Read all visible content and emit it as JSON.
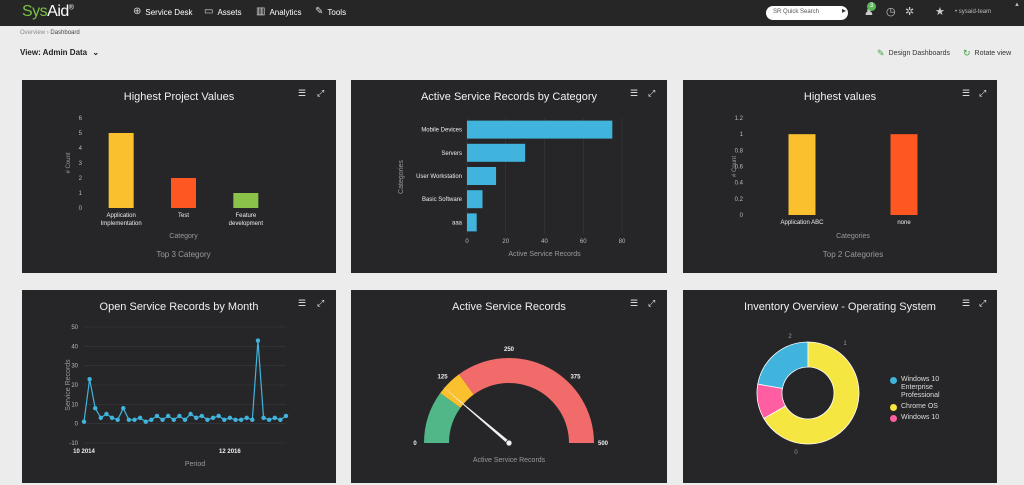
{
  "header": {
    "logo_a": "Sys",
    "logo_b": "Aid",
    "logo_mark": "®",
    "nav": [
      {
        "label": "Service Desk",
        "icon": "globe-icon"
      },
      {
        "label": "Assets",
        "icon": "monitor-icon"
      },
      {
        "label": "Analytics",
        "icon": "bar-chart-icon"
      },
      {
        "label": "Tools",
        "icon": "wrench-icon"
      }
    ],
    "search_placeholder": "SR Quick Search",
    "notification_count": "3",
    "user": "sysaid-team"
  },
  "breadcrumb": {
    "root": "Overview",
    "separator": "›",
    "current": "Dashboard"
  },
  "toolbar": {
    "view_label": "View: Admin Data",
    "design_label": "Design Dashboards",
    "rotate_label": "Rotate view"
  },
  "colors": {
    "card_bg": "#262629",
    "yellow": "#fbc02d",
    "orange": "#ff5722",
    "green": "#8bc34a",
    "blue": "#40b4dc",
    "pink": "#ff5fa2",
    "gauge_green": "#52b788",
    "gauge_red": "#f26b6b",
    "chrome_yellow": "#f5e642"
  },
  "cards": [
    {
      "title": "Highest Project Values"
    },
    {
      "title": "Active Service Records by Category"
    },
    {
      "title": "Highest values"
    },
    {
      "title": "Open Service Records by Month"
    },
    {
      "title": "Active Service Records"
    },
    {
      "title": "Inventory Overview - Operating System"
    }
  ],
  "chart_data": [
    {
      "type": "bar",
      "title": "Highest Project Values",
      "subtitle": "Top 3 Category",
      "xlabel": "Category",
      "ylabel": "# Count",
      "ylim": [
        0,
        6
      ],
      "yticks": [
        "0",
        "1",
        "2",
        "3",
        "4",
        "5",
        "6"
      ],
      "categories": [
        "Application Implementation",
        "Test",
        "Feature development"
      ],
      "category_lines": [
        [
          "Application",
          "Implementation"
        ],
        [
          "Test"
        ],
        [
          "Feature",
          "development"
        ]
      ],
      "values": [
        5,
        2,
        1
      ],
      "colors": [
        "#fbc02d",
        "#ff5722",
        "#8bc34a"
      ]
    },
    {
      "type": "bar",
      "orientation": "horizontal",
      "title": "Active Service Records by Category",
      "xlabel": "Active Service Records",
      "ylabel": "Categories",
      "xlim": [
        0,
        80
      ],
      "xticks": [
        "0",
        "20",
        "40",
        "60",
        "80"
      ],
      "categories": [
        "Mobile Devices",
        "Servers",
        "User Workstation",
        "Basic Software",
        "aaa"
      ],
      "values": [
        75,
        30,
        15,
        8,
        5
      ],
      "color": "#40b4dc"
    },
    {
      "type": "bar",
      "title": "Highest values",
      "subtitle": "Top 2 Categories",
      "xlabel": "Categories",
      "ylabel": "# Count",
      "ylim": [
        0,
        1.2
      ],
      "yticks": [
        "0",
        "0.2",
        "0.4",
        "0.6",
        "0.8",
        "1",
        "1.2"
      ],
      "categories": [
        "Application ABC",
        "none"
      ],
      "values": [
        1,
        1
      ],
      "colors": [
        "#fbc02d",
        "#ff5722"
      ]
    },
    {
      "type": "line",
      "title": "Open Service Records by Month",
      "xlabel": "Period",
      "ylabel": "Service Records",
      "ylim": [
        -10,
        50
      ],
      "yticks": [
        "-10",
        "0",
        "10",
        "20",
        "30",
        "40",
        "50"
      ],
      "xtick_labels": [
        {
          "index": 0,
          "label": "10 2014"
        },
        {
          "index": 26,
          "label": "12 2016"
        }
      ],
      "values": [
        1,
        23,
        8,
        3,
        5,
        3,
        2,
        8,
        2,
        2,
        3,
        1,
        2,
        4,
        2,
        4,
        2,
        4,
        2,
        5,
        3,
        4,
        2,
        3,
        4,
        2,
        3,
        2,
        2,
        3,
        2,
        43,
        3,
        2,
        3,
        2,
        4
      ],
      "color": "#40b4dc"
    },
    {
      "type": "gauge",
      "title": "Active Service Records",
      "xlabel": "Active Service Records",
      "range": [
        0,
        500
      ],
      "ticks": [
        "0",
        "125",
        "250",
        "375",
        "500"
      ],
      "bands": [
        {
          "from": 0,
          "to": 100,
          "color": "#52b788"
        },
        {
          "from": 100,
          "to": 150,
          "color": "#fbc02d"
        },
        {
          "from": 150,
          "to": 500,
          "color": "#f26b6b"
        }
      ],
      "value": 112
    },
    {
      "type": "pie",
      "title": "Inventory Overview - Operating System",
      "labels": [
        "Windows 10 Enterprise Professional",
        "Chrome OS",
        "Windows 10"
      ],
      "legend_lines": [
        [
          "Windows 10",
          "Enterprise",
          "Professional"
        ],
        [
          "Chrome OS"
        ],
        [
          "Windows 10"
        ]
      ],
      "values": [
        2,
        6,
        1
      ],
      "slice_labels": [
        "2",
        "0",
        "1"
      ],
      "colors": [
        "#40b4dc",
        "#f5e642",
        "#ff5fa2"
      ]
    }
  ]
}
